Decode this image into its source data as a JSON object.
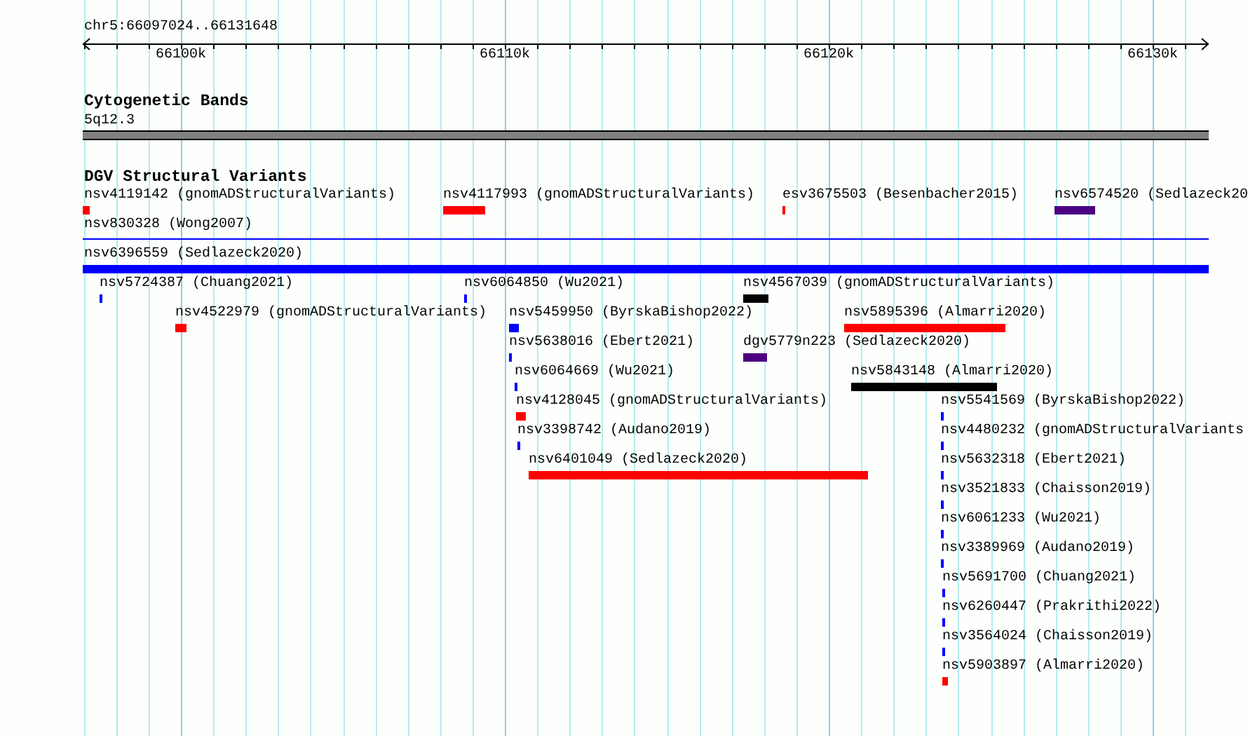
{
  "ruler": {
    "location": "chr5:66097024..66131648",
    "ticks": [
      "66100k",
      "66110k",
      "66120k",
      "66130k"
    ]
  },
  "tracks": [
    {
      "kind": "bands",
      "title": "Cytogenetic Bands",
      "features": [
        {
          "label": "5q12.3"
        }
      ]
    },
    {
      "kind": "variants",
      "title": "DGV Structural Variants",
      "features": [
        {
          "label": "nsv4119142 (gnomADStructuralVariants)",
          "kind": "bar",
          "color": "#ff0000"
        },
        {
          "label": "nsv4117993 (gnomADStructuralVariants)",
          "kind": "bar",
          "color": "#ff0000"
        },
        {
          "label": "esv3675503 (Besenbacher2015)",
          "kind": "bar",
          "color": "#ff0000"
        },
        {
          "label": "nsv6574520 (Sedlazeck20",
          "kind": "bar",
          "color": "#4b0082"
        },
        {
          "label": "nsv830328 (Wong2007)",
          "kind": "line",
          "color": "#0000ff"
        },
        {
          "label": "nsv6396559 (Sedlazeck2020)",
          "kind": "bar",
          "color": "#0000ff"
        },
        {
          "label": "nsv5724387 (Chuang2021)",
          "kind": "bar",
          "color": "#0000ff"
        },
        {
          "label": "nsv6064850 (Wu2021)",
          "kind": "bar",
          "color": "#0000ff"
        },
        {
          "label": "nsv4567039 (gnomADStructuralVariants)",
          "kind": "bar",
          "color": "#000000"
        },
        {
          "label": "nsv4522979 (gnomADStructuralVariants)",
          "kind": "bar",
          "color": "#ff0000"
        },
        {
          "label": "nsv5459950 (ByrskaBishop2022)",
          "kind": "bar",
          "color": "#0000ff"
        },
        {
          "label": "nsv5895396 (Almarri2020)",
          "kind": "bar",
          "color": "#ff0000"
        },
        {
          "label": "nsv5638016 (Ebert2021)",
          "kind": "bar",
          "color": "#0000ff"
        },
        {
          "label": "dgv5779n223 (Sedlazeck2020)",
          "kind": "bar",
          "color": "#4b0082"
        },
        {
          "label": "nsv6064669 (Wu2021)",
          "kind": "bar",
          "color": "#0000ff"
        },
        {
          "label": "nsv5843148 (Almarri2020)",
          "kind": "bar",
          "color": "#000000"
        },
        {
          "label": "nsv4128045 (gnomADStructuralVariants)",
          "kind": "bar",
          "color": "#ff0000"
        },
        {
          "label": "nsv5541569 (ByrskaBishop2022)",
          "kind": "bar",
          "color": "#0000ff"
        },
        {
          "label": "nsv3398742 (Audano2019)",
          "kind": "bar",
          "color": "#0000ff"
        },
        {
          "label": "nsv4480232 (gnomADStructuralVariants",
          "kind": "bar",
          "color": "#0000ff"
        },
        {
          "label": "nsv6401049 (Sedlazeck2020)",
          "kind": "bar",
          "color": "#ff0000"
        },
        {
          "label": "nsv5632318 (Ebert2021)",
          "kind": "bar",
          "color": "#0000ff"
        },
        {
          "label": "nsv3521833 (Chaisson2019)",
          "kind": "bar",
          "color": "#0000ff"
        },
        {
          "label": "nsv6061233 (Wu2021)",
          "kind": "bar",
          "color": "#0000ff"
        },
        {
          "label": "nsv3389969 (Audano2019)",
          "kind": "bar",
          "color": "#0000ff"
        },
        {
          "label": "nsv5691700 (Chuang2021)",
          "kind": "bar",
          "color": "#0000ff"
        },
        {
          "label": "nsv6260447 (Prakrithi2022)",
          "kind": "bar",
          "color": "#0000ff"
        },
        {
          "label": "nsv3564024 (Chaisson2019)",
          "kind": "bar",
          "color": "#0000ff"
        },
        {
          "label": "nsv5903897 (Almarri2020)",
          "kind": "bar",
          "color": "#ff0000"
        }
      ]
    }
  ]
}
